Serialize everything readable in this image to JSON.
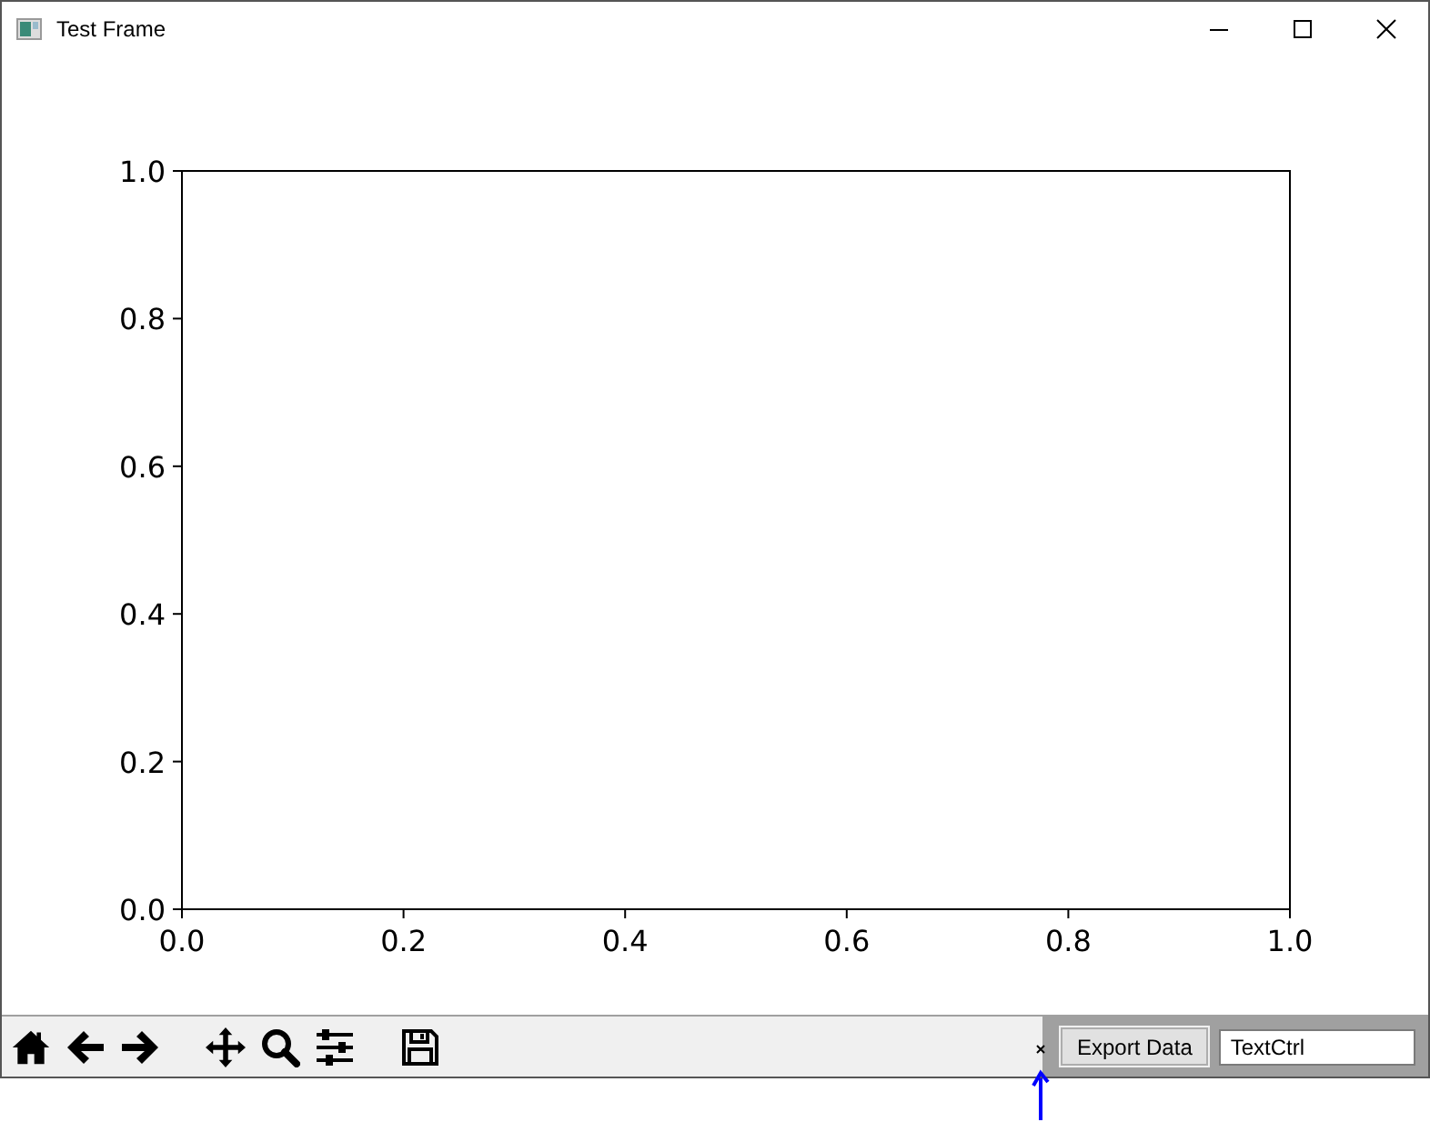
{
  "window": {
    "title": "Test Frame"
  },
  "plot": {
    "chart_data": {
      "type": "line",
      "xlim": [
        0,
        1
      ],
      "ylim": [
        0,
        1
      ],
      "xticks": [
        {
          "value": 0,
          "label": "0.0"
        },
        {
          "value": 0.2,
          "label": "0.2"
        },
        {
          "value": 0.4,
          "label": "0.4"
        },
        {
          "value": 0.6,
          "label": "0.6"
        },
        {
          "value": 0.8,
          "label": "0.8"
        },
        {
          "value": 1,
          "label": "1.0"
        }
      ],
      "yticks": [
        {
          "value": 0,
          "label": "0.0"
        },
        {
          "value": 0.2,
          "label": "0.2"
        },
        {
          "value": 0.4,
          "label": "0.4"
        },
        {
          "value": 0.6,
          "label": "0.6"
        },
        {
          "value": 0.8,
          "label": "0.8"
        },
        {
          "value": 1,
          "label": "1.0"
        }
      ]
    }
  },
  "toolbar": {
    "tools": [
      {
        "kind": "home"
      },
      {
        "kind": "back"
      },
      {
        "kind": "forward"
      },
      {
        "kind": "spacer"
      },
      {
        "kind": "pan"
      },
      {
        "kind": "zoom"
      },
      {
        "kind": "configure"
      },
      {
        "kind": "spacer"
      },
      {
        "kind": "save"
      }
    ]
  },
  "panel": {
    "button": "Export Data",
    "field_value": "TextCtrl"
  }
}
